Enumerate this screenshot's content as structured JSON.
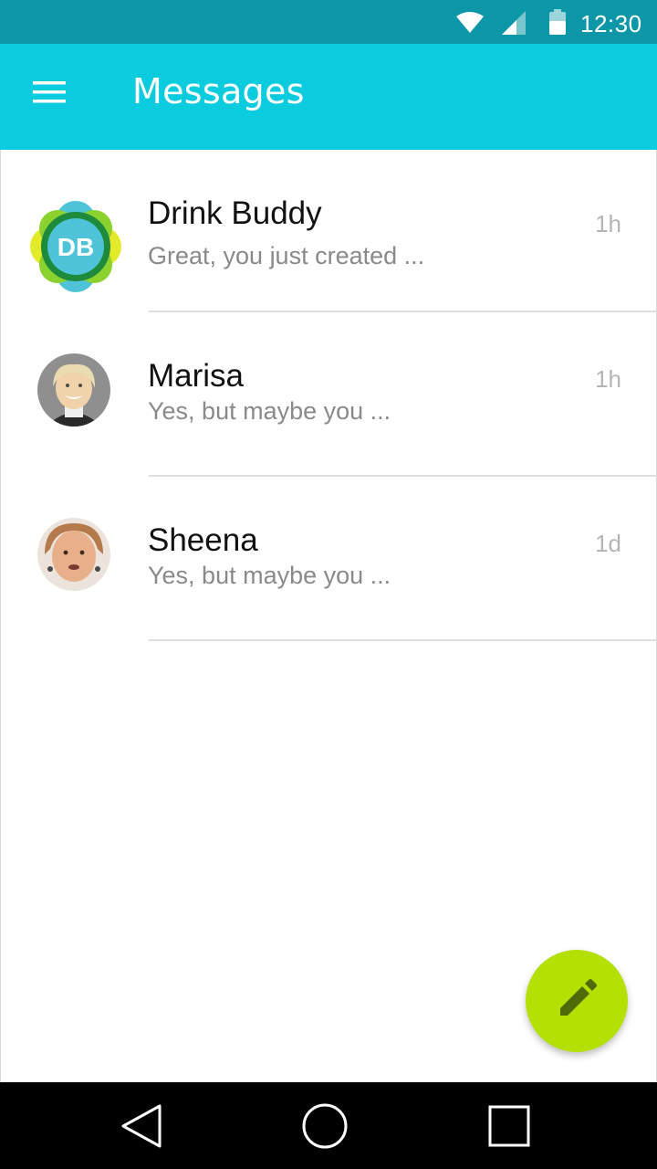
{
  "status_bar": {
    "time": "12:30",
    "icons": [
      "wifi-icon",
      "cellular-signal-icon",
      "battery-icon"
    ]
  },
  "app_bar": {
    "menu_icon": "menu-icon",
    "title": "Messages"
  },
  "conversations": [
    {
      "name": "Drink Buddy",
      "preview": "Great, you just created ...",
      "time": "1h",
      "avatar": {
        "type": "logo",
        "initials": "DB"
      }
    },
    {
      "name": "Marisa",
      "preview": "Yes, but maybe you ...",
      "time": "1h",
      "avatar": {
        "type": "photo"
      }
    },
    {
      "name": "Sheena",
      "preview": "Yes, but maybe you ...",
      "time": "1d",
      "avatar": {
        "type": "photo"
      }
    }
  ],
  "fab": {
    "icon": "pencil-icon"
  },
  "nav_bar": {
    "icons": [
      "back-icon",
      "home-icon",
      "recents-icon"
    ]
  },
  "colors": {
    "status_bar": "#0b97a8",
    "app_bar": "#0bcbdf",
    "fab": "#b5e003",
    "name_text": "#111111",
    "preview_text": "#8a8a8a",
    "time_text": "#b5b5b5"
  }
}
